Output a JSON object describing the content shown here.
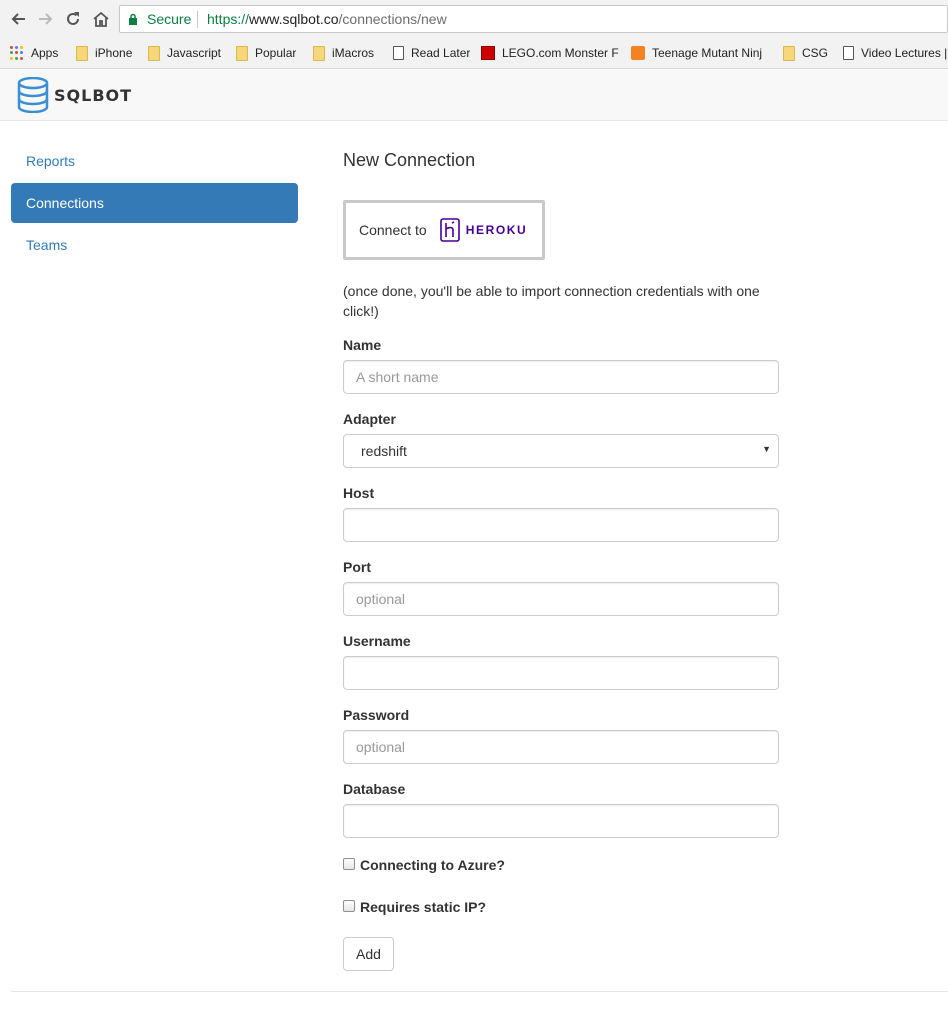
{
  "browser": {
    "secure_label": "Secure",
    "url_scheme": "https://",
    "url_host": "www.sqlbot.co",
    "url_path": "/connections/new",
    "bookmarks": [
      {
        "label": "Apps",
        "icon": "apps-grid-icon"
      },
      {
        "label": "iPhone",
        "icon": "folder-icon"
      },
      {
        "label": "Javascript",
        "icon": "folder-icon"
      },
      {
        "label": "Popular",
        "icon": "folder-icon"
      },
      {
        "label": "iMacros",
        "icon": "folder-icon"
      },
      {
        "label": "Read Later",
        "icon": "page-icon"
      },
      {
        "label": "LEGO.com Monster Fi",
        "icon": "lego-icon"
      },
      {
        "label": "Teenage Mutant Ninj",
        "icon": "tmnt-icon"
      },
      {
        "label": "CSG",
        "icon": "folder-icon"
      },
      {
        "label": "Video Lectures |",
        "icon": "page-icon"
      }
    ]
  },
  "app": {
    "logo_text": "SQLBOT",
    "brand_color": "#337ab7"
  },
  "sidebar": {
    "items": [
      {
        "label": "Reports",
        "active": false
      },
      {
        "label": "Connections",
        "active": true
      },
      {
        "label": "Teams",
        "active": false
      }
    ]
  },
  "main": {
    "title": "New Connection",
    "heroku": {
      "connect_label": "Connect to",
      "brand_label": "HEROKU",
      "brand_color": "#430098"
    },
    "help_text": "(once done, you'll be able to import connection credentials with one click!)",
    "fields": {
      "name": {
        "label": "Name",
        "placeholder": "A short name",
        "value": ""
      },
      "adapter": {
        "label": "Adapter",
        "value": "redshift"
      },
      "host": {
        "label": "Host",
        "placeholder": "",
        "value": ""
      },
      "port": {
        "label": "Port",
        "placeholder": "optional",
        "value": ""
      },
      "username": {
        "label": "Username",
        "placeholder": "",
        "value": ""
      },
      "password": {
        "label": "Password",
        "placeholder": "optional",
        "value": ""
      },
      "database": {
        "label": "Database",
        "placeholder": "",
        "value": ""
      }
    },
    "checkboxes": {
      "azure": {
        "label": "Connecting to Azure?",
        "checked": false
      },
      "static_ip": {
        "label": "Requires static IP?",
        "checked": false
      }
    },
    "submit_label": "Add"
  }
}
